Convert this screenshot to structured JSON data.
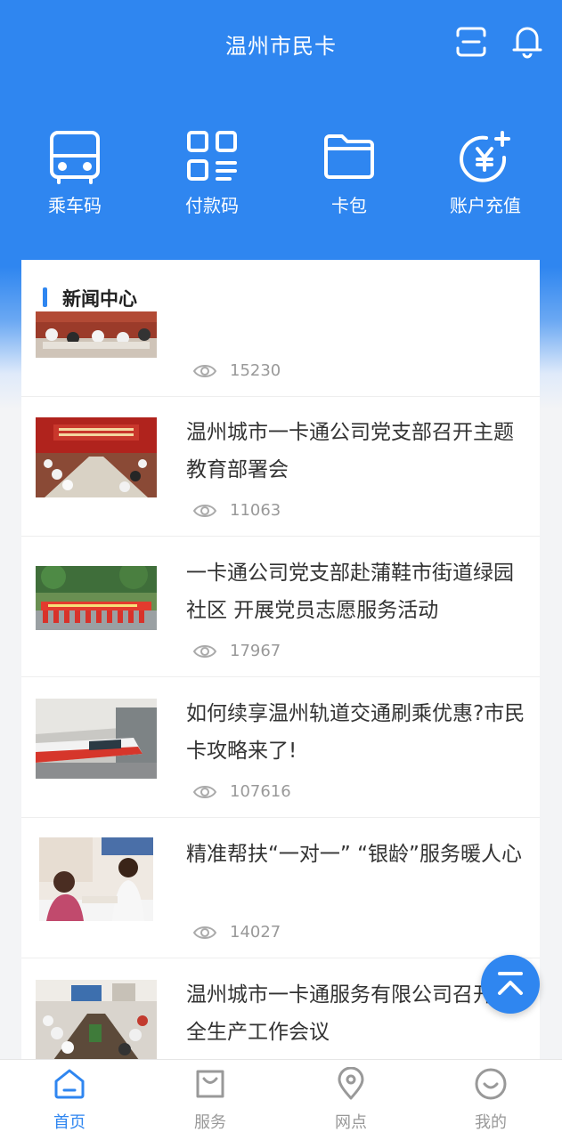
{
  "header": {
    "title": "温州市民卡"
  },
  "quick_actions": [
    {
      "label": "乘车码",
      "icon": "bus-icon"
    },
    {
      "label": "付款码",
      "icon": "qrcode-icon"
    },
    {
      "label": "卡包",
      "icon": "folder-icon"
    },
    {
      "label": "账户充值",
      "icon": "yuan-plus-icon"
    }
  ],
  "news": {
    "section_title": "新闻中心",
    "items": [
      {
        "title": "",
        "views": "15230"
      },
      {
        "title": "温州城市一卡通公司党支部召开主题教育部署会",
        "views": "11063"
      },
      {
        "title": "一卡通公司党支部赴蒲鞋市街道绿园社区 开展党员志愿服务活动",
        "views": "17967"
      },
      {
        "title": "如何续享温州轨道交通刷乘优惠?市民卡攻略来了!",
        "views": "107616"
      },
      {
        "title": "精准帮扶“一对一” “银龄”服务暖人心",
        "views": "14027"
      },
      {
        "title": "温州城市一卡通服务有限公司召开安全生产工作会议",
        "views": ""
      }
    ]
  },
  "tabbar": [
    {
      "label": "首页",
      "icon": "home-icon",
      "active": true
    },
    {
      "label": "服务",
      "icon": "bag-icon",
      "active": false
    },
    {
      "label": "网点",
      "icon": "location-pin-icon",
      "active": false
    },
    {
      "label": "我的",
      "icon": "smile-face-icon",
      "active": false
    }
  ],
  "colors": {
    "primary": "#2f86f0",
    "tab_inactive": "#999999"
  }
}
